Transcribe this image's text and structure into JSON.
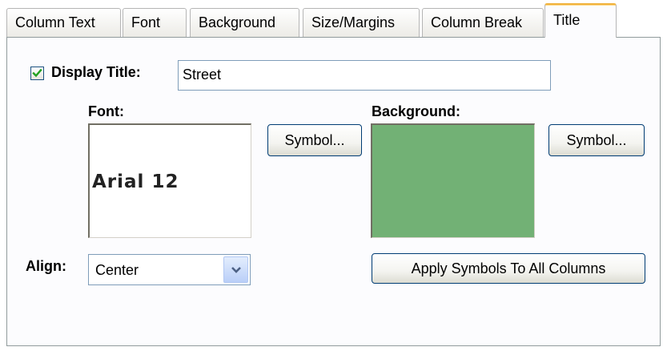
{
  "tabs": [
    {
      "label": "Column Text"
    },
    {
      "label": "Font"
    },
    {
      "label": "Background"
    },
    {
      "label": "Size/Margins"
    },
    {
      "label": "Column Break"
    },
    {
      "label": "Title",
      "active": true
    }
  ],
  "title_section": {
    "display_title_checked": true,
    "display_title_label": "Display Title:",
    "title_value": "Street"
  },
  "font_section": {
    "label": "Font:",
    "preview_text": "Arial  12",
    "symbol_button": "Symbol..."
  },
  "background_section": {
    "label": "Background:",
    "swatch_color": "#72b175",
    "symbol_button": "Symbol..."
  },
  "align_section": {
    "label": "Align:",
    "selected": "Center"
  },
  "apply_button": "Apply Symbols To All Columns",
  "colors": {
    "active_tab_accent": "#f0b23c",
    "checkbox_check": "#21a121",
    "dropdown_arrow": "#4d6185"
  },
  "icons": {
    "checkbox": "check-icon",
    "dropdown": "chevron-down-icon"
  }
}
